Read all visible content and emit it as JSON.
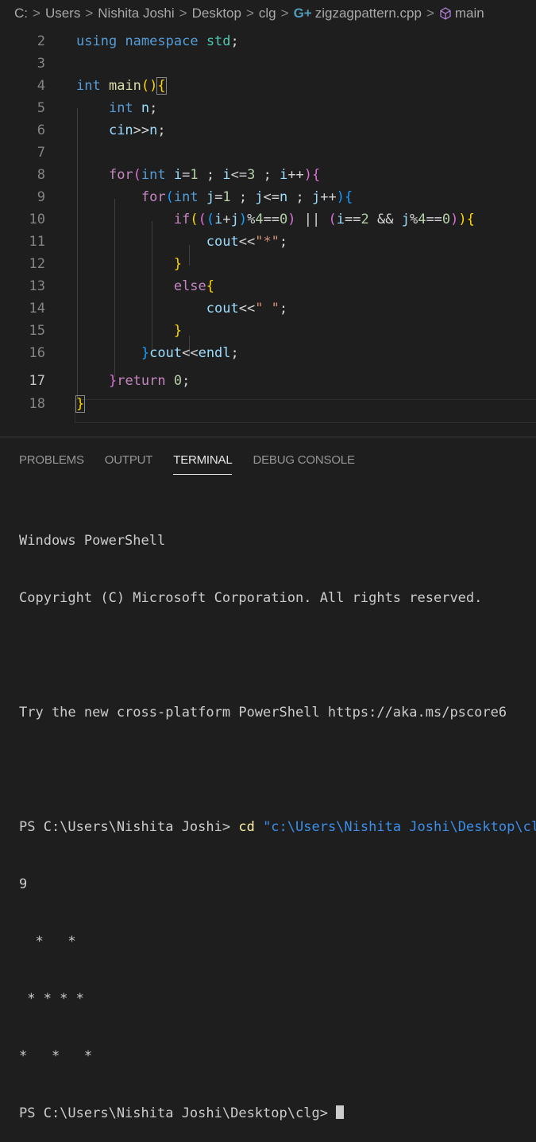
{
  "breadcrumb": {
    "items": [
      "C:",
      "Users",
      "Nishita Joshi",
      "Desktop",
      "clg",
      "zigzagpattern.cpp",
      "main"
    ],
    "separator": ">"
  },
  "editor": {
    "line_numbers": [
      "2",
      "3",
      "4",
      "5",
      "6",
      "7",
      "8",
      "9",
      "10",
      "11",
      "12",
      "13",
      "14",
      "15",
      "16",
      "17",
      "18"
    ],
    "active_line": "17"
  },
  "panel": {
    "tabs": [
      "PROBLEMS",
      "OUTPUT",
      "TERMINAL",
      "DEBUG CONSOLE"
    ],
    "active_tab": "TERMINAL"
  },
  "terminal": {
    "lines": [
      "Windows PowerShell",
      "Copyright (C) Microsoft Corporation. All rights reserved.",
      "",
      "Try the new cross-platform PowerShell https://aka.ms/pscore6",
      ""
    ],
    "prompt": "PS C:\\Users\\Nishita Joshi> ",
    "command": "cd",
    "command_arg": " \"c:\\Users\\Nishita Joshi\\Desktop\\clg\\\"",
    "input_value": "9",
    "output": [
      "  *   *",
      " * * * *",
      "*   *   *"
    ],
    "final_prompt": "PS C:\\Users\\Nishita Joshi\\Desktop\\clg> "
  },
  "colors": {
    "background": "#1e1e1e",
    "keyword": "#569cd6",
    "control": "#c586c0",
    "string": "#ce9178",
    "number": "#b5cea8",
    "variable": "#9cdcfe",
    "function": "#dcdcaa"
  }
}
